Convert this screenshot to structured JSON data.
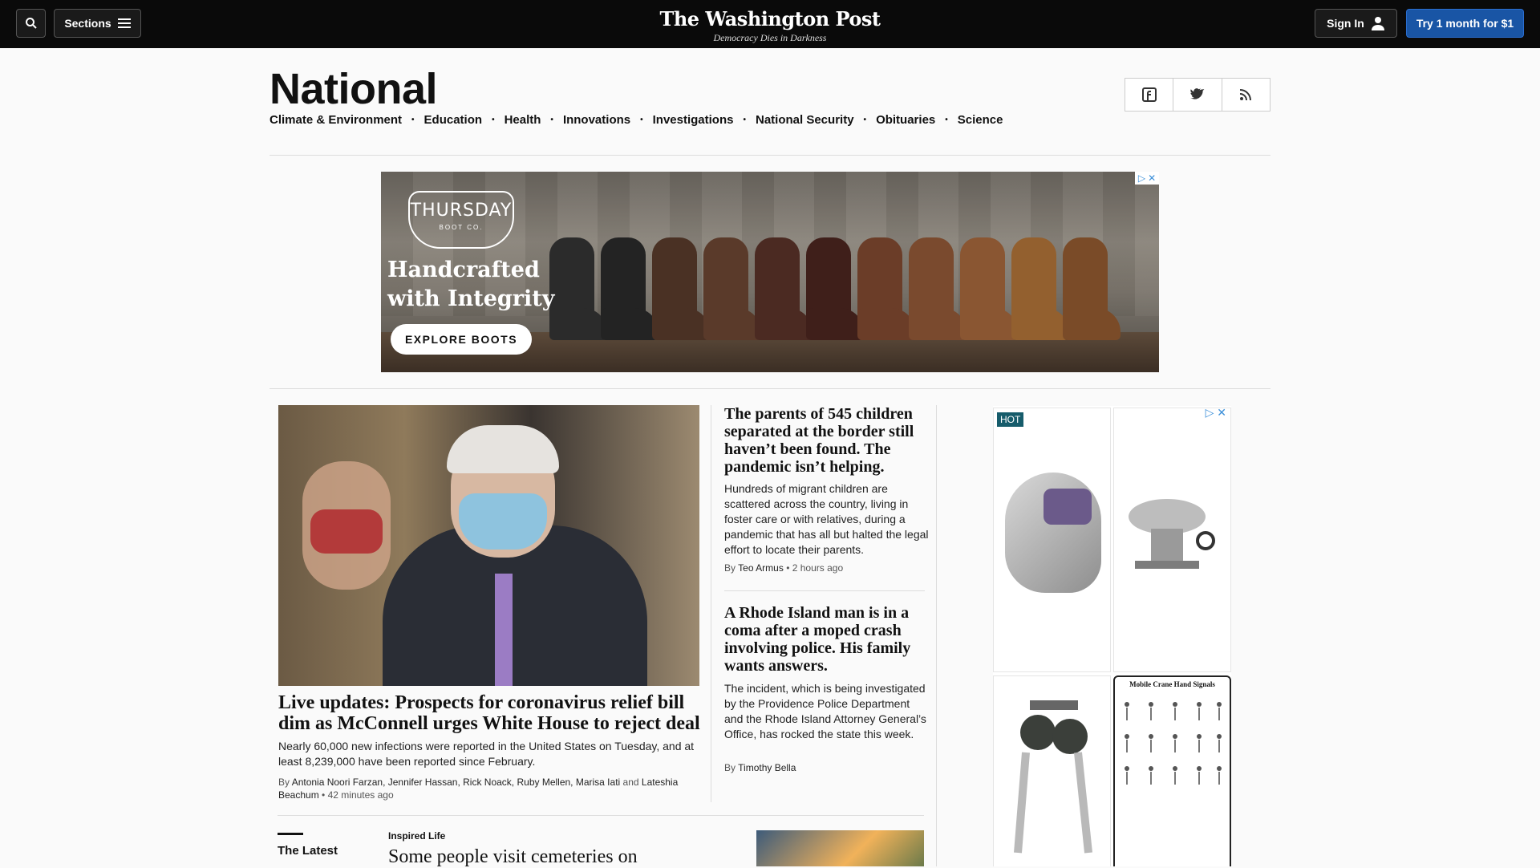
{
  "header": {
    "sections_label": "Sections",
    "logo": "The Washington Post",
    "tagline": "Democracy Dies in Darkness",
    "signin_label": "Sign In",
    "subscribe_label": "Try 1 month for $1"
  },
  "page": {
    "title": "National",
    "subnav": [
      "Climate & Environment",
      "Education",
      "Health",
      "Innovations",
      "Investigations",
      "National Security",
      "Obituaries",
      "Science"
    ]
  },
  "ad_banner": {
    "brand": "THURSDAY",
    "brand_sub": "BOOT CO.",
    "headline_1": "Handcrafted",
    "headline_2": "with Integrity",
    "cta": "EXPLORE BOOTS"
  },
  "lead_story": {
    "headline": "Live updates: Prospects for coronavirus relief bill dim as McConnell urges White House to reject deal",
    "blurb": "Nearly 60,000 new infections were reported in the United States on Tuesday, and at least 8,239,000 have been reported since February.",
    "by": "By",
    "authors": "Antonia Noori Farzan, Jennifer Hassan, Rick Noack, Ruby Mellen, Marisa Iati",
    "and": "and",
    "last_author": "Lateshia Beachum",
    "time": "42 minutes ago"
  },
  "stories": [
    {
      "headline": "The parents of 545 children separated at the border still haven’t been found. The pandemic isn’t helping.",
      "blurb": "Hundreds of migrant children are scattered across the country, living in foster care or with relatives, during a pandemic that has all but halted the legal effort to locate their parents.",
      "by": "By",
      "author": "Teo Armus",
      "time": "2 hours ago"
    },
    {
      "headline": "A Rhode Island man is in a coma after a moped crash involving police. His family wants answers.",
      "blurb": "The incident, which is being investigated by the Providence Police Department and the Rhode Island Attorney General’s Office, has rocked the state this week.",
      "by": "By",
      "author": "Timothy Bella"
    }
  ],
  "side_ad": {
    "badge": "HOT",
    "chart_title": "Mobile Crane Hand Signals"
  },
  "latest": {
    "label": "The Latest",
    "kicker": "Inspired Life",
    "headline": "Some people visit cemeteries on"
  },
  "colors": {
    "topbar": "#0a0a0a",
    "subscribe": "#1955a5",
    "adchoice": "#3b8fd9"
  }
}
